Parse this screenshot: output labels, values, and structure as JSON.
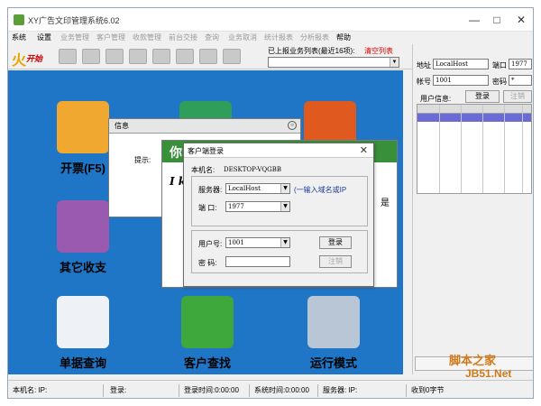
{
  "window": {
    "title": "XY广告文印管理系统6.02",
    "minimize": "—",
    "maximize": "□",
    "close": "✕"
  },
  "menu": [
    {
      "label": "系统",
      "dim": false
    },
    {
      "label": "设置",
      "dim": false
    },
    {
      "label": "业务管理",
      "dim": true
    },
    {
      "label": "客户管理",
      "dim": true
    },
    {
      "label": "收款管理",
      "dim": true
    },
    {
      "label": "前台交接",
      "dim": true
    },
    {
      "label": "查询",
      "dim": true
    },
    {
      "label": "业务取消",
      "dim": true
    },
    {
      "label": "统计报表",
      "dim": true
    },
    {
      "label": "分析报表",
      "dim": true
    },
    {
      "label": "帮助",
      "dim": false
    }
  ],
  "toolbar": {
    "start_glyph": "火",
    "start_label": "开始",
    "tasks_caption": "已上报业务列表(最近16项):",
    "clear_link": "清空列表",
    "tasks_value": ""
  },
  "tiles": {
    "billing": "开票(F5)",
    "other_payments": "其它收支",
    "document_query": "单据查询",
    "customer_search": "客户查找",
    "run_mode": "运行模式"
  },
  "right_panel": {
    "address_label": "地址",
    "address_value": "LocalHost",
    "port_label": "端口",
    "port_value": "1977",
    "account_label": "帐号",
    "account_value": "1001",
    "password_label": "密码",
    "password_value": "*",
    "user_info_label": "用户信息:",
    "login_button": "登录",
    "logout_button": "注销",
    "watermark_text": "脚本之家",
    "watermark_url": "JB51.Net"
  },
  "status_bar": {
    "machine": "本机名: IP:",
    "login": "登录:",
    "login_time": "登录时间:0:00:00",
    "system_time": "系统时间:0:00:00",
    "server": "服务器: IP:",
    "received": "收到0字节"
  },
  "info_dialog": {
    "title": "信息",
    "prompt": "提示:"
  },
  "background_panel": {
    "heading": "你",
    "text": "I kn",
    "side_char": "是"
  },
  "login_dialog": {
    "title": "客户端登录",
    "close": "✕",
    "machine_label": "本机名:",
    "machine_value": "DESKTOP-VQGBB",
    "server_label": "服务器:",
    "server_value": "LocalHost",
    "server_hint": "(一输入域名或IP",
    "port_label": "端 口:",
    "port_value": "1977",
    "user_label": "用户号:",
    "user_value": "1001",
    "password_label": "密 码:",
    "password_value": "",
    "login_button": "登录",
    "logout_button": "注销"
  },
  "colors": {
    "main_bg": "#1f76c6",
    "dialog_green": "#3a8f3a",
    "accent_red": "#d00000",
    "grid_selection": "#6b6bd6"
  }
}
